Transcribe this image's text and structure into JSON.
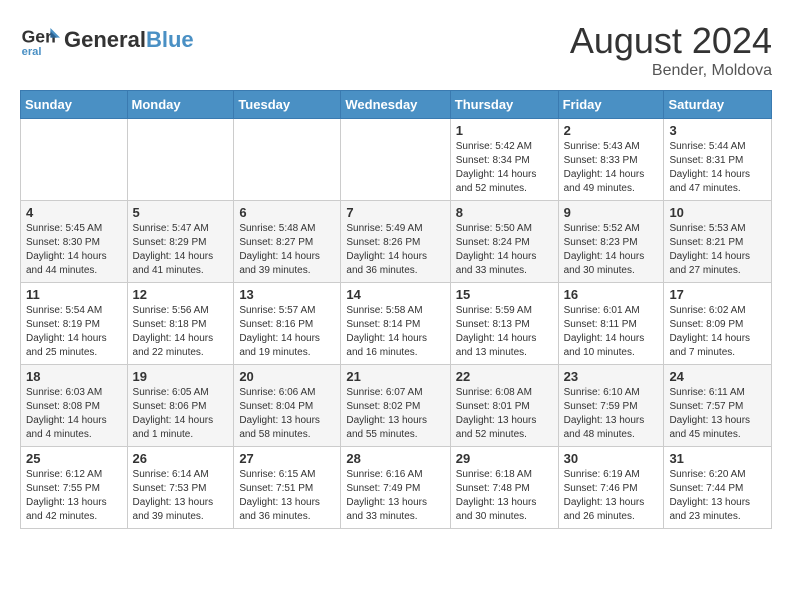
{
  "header": {
    "logo_line1": "General",
    "logo_line2": "Blue",
    "month_year": "August 2024",
    "location": "Bender, Moldova"
  },
  "weekdays": [
    "Sunday",
    "Monday",
    "Tuesday",
    "Wednesday",
    "Thursday",
    "Friday",
    "Saturday"
  ],
  "weeks": [
    [
      {
        "day": "",
        "info": ""
      },
      {
        "day": "",
        "info": ""
      },
      {
        "day": "",
        "info": ""
      },
      {
        "day": "",
        "info": ""
      },
      {
        "day": "1",
        "info": "Sunrise: 5:42 AM\nSunset: 8:34 PM\nDaylight: 14 hours and 52 minutes."
      },
      {
        "day": "2",
        "info": "Sunrise: 5:43 AM\nSunset: 8:33 PM\nDaylight: 14 hours and 49 minutes."
      },
      {
        "day": "3",
        "info": "Sunrise: 5:44 AM\nSunset: 8:31 PM\nDaylight: 14 hours and 47 minutes."
      }
    ],
    [
      {
        "day": "4",
        "info": "Sunrise: 5:45 AM\nSunset: 8:30 PM\nDaylight: 14 hours and 44 minutes."
      },
      {
        "day": "5",
        "info": "Sunrise: 5:47 AM\nSunset: 8:29 PM\nDaylight: 14 hours and 41 minutes."
      },
      {
        "day": "6",
        "info": "Sunrise: 5:48 AM\nSunset: 8:27 PM\nDaylight: 14 hours and 39 minutes."
      },
      {
        "day": "7",
        "info": "Sunrise: 5:49 AM\nSunset: 8:26 PM\nDaylight: 14 hours and 36 minutes."
      },
      {
        "day": "8",
        "info": "Sunrise: 5:50 AM\nSunset: 8:24 PM\nDaylight: 14 hours and 33 minutes."
      },
      {
        "day": "9",
        "info": "Sunrise: 5:52 AM\nSunset: 8:23 PM\nDaylight: 14 hours and 30 minutes."
      },
      {
        "day": "10",
        "info": "Sunrise: 5:53 AM\nSunset: 8:21 PM\nDaylight: 14 hours and 27 minutes."
      }
    ],
    [
      {
        "day": "11",
        "info": "Sunrise: 5:54 AM\nSunset: 8:19 PM\nDaylight: 14 hours and 25 minutes."
      },
      {
        "day": "12",
        "info": "Sunrise: 5:56 AM\nSunset: 8:18 PM\nDaylight: 14 hours and 22 minutes."
      },
      {
        "day": "13",
        "info": "Sunrise: 5:57 AM\nSunset: 8:16 PM\nDaylight: 14 hours and 19 minutes."
      },
      {
        "day": "14",
        "info": "Sunrise: 5:58 AM\nSunset: 8:14 PM\nDaylight: 14 hours and 16 minutes."
      },
      {
        "day": "15",
        "info": "Sunrise: 5:59 AM\nSunset: 8:13 PM\nDaylight: 14 hours and 13 minutes."
      },
      {
        "day": "16",
        "info": "Sunrise: 6:01 AM\nSunset: 8:11 PM\nDaylight: 14 hours and 10 minutes."
      },
      {
        "day": "17",
        "info": "Sunrise: 6:02 AM\nSunset: 8:09 PM\nDaylight: 14 hours and 7 minutes."
      }
    ],
    [
      {
        "day": "18",
        "info": "Sunrise: 6:03 AM\nSunset: 8:08 PM\nDaylight: 14 hours and 4 minutes."
      },
      {
        "day": "19",
        "info": "Sunrise: 6:05 AM\nSunset: 8:06 PM\nDaylight: 14 hours and 1 minute."
      },
      {
        "day": "20",
        "info": "Sunrise: 6:06 AM\nSunset: 8:04 PM\nDaylight: 13 hours and 58 minutes."
      },
      {
        "day": "21",
        "info": "Sunrise: 6:07 AM\nSunset: 8:02 PM\nDaylight: 13 hours and 55 minutes."
      },
      {
        "day": "22",
        "info": "Sunrise: 6:08 AM\nSunset: 8:01 PM\nDaylight: 13 hours and 52 minutes."
      },
      {
        "day": "23",
        "info": "Sunrise: 6:10 AM\nSunset: 7:59 PM\nDaylight: 13 hours and 48 minutes."
      },
      {
        "day": "24",
        "info": "Sunrise: 6:11 AM\nSunset: 7:57 PM\nDaylight: 13 hours and 45 minutes."
      }
    ],
    [
      {
        "day": "25",
        "info": "Sunrise: 6:12 AM\nSunset: 7:55 PM\nDaylight: 13 hours and 42 minutes."
      },
      {
        "day": "26",
        "info": "Sunrise: 6:14 AM\nSunset: 7:53 PM\nDaylight: 13 hours and 39 minutes."
      },
      {
        "day": "27",
        "info": "Sunrise: 6:15 AM\nSunset: 7:51 PM\nDaylight: 13 hours and 36 minutes."
      },
      {
        "day": "28",
        "info": "Sunrise: 6:16 AM\nSunset: 7:49 PM\nDaylight: 13 hours and 33 minutes."
      },
      {
        "day": "29",
        "info": "Sunrise: 6:18 AM\nSunset: 7:48 PM\nDaylight: 13 hours and 30 minutes."
      },
      {
        "day": "30",
        "info": "Sunrise: 6:19 AM\nSunset: 7:46 PM\nDaylight: 13 hours and 26 minutes."
      },
      {
        "day": "31",
        "info": "Sunrise: 6:20 AM\nSunset: 7:44 PM\nDaylight: 13 hours and 23 minutes."
      }
    ]
  ]
}
